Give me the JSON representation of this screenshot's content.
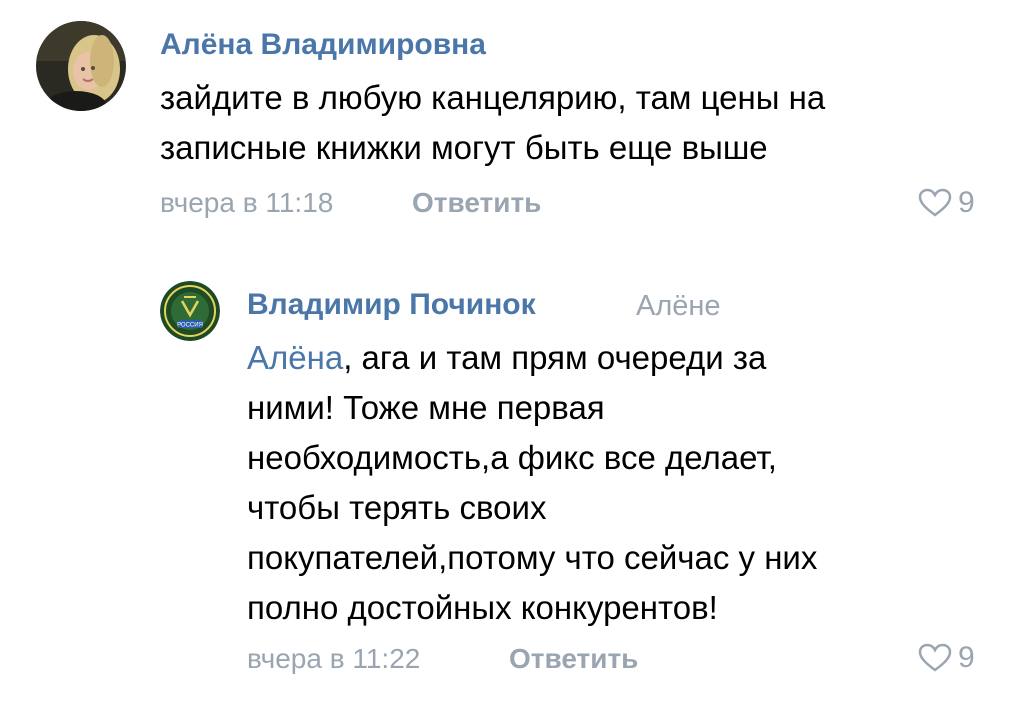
{
  "comments": [
    {
      "author": "Алёна Владимировна",
      "text_lines": [
        "зайдите в любую канцелярию, там цены на",
        "записные книжки могут быть еще выше"
      ],
      "time": "вчера в 11:18",
      "reply_label": "Ответить",
      "likes": "9",
      "avatar_icon": "user-photo"
    },
    {
      "author": "Владимир Починок",
      "reply_to": "Алёне",
      "mention": "Алёна",
      "first_line_rest": ", ага и там прям очереди за",
      "text_lines": [
        "ними! Тоже мне первая",
        "необходимость,а фикс все делает,",
        "чтобы терять своих",
        "покупателей,потому что сейчас у них",
        "полно достойных конкурентов!"
      ],
      "time": "вчера в 11:22",
      "reply_label": "Ответить",
      "likes": "9",
      "avatar_icon": "emblem-badge",
      "avatar_emblem_text": "РОССИЯ"
    }
  ],
  "colors": {
    "link": "#4a76a8",
    "muted": "#9aa5b1",
    "text": "#000000",
    "background": "#ffffff"
  }
}
